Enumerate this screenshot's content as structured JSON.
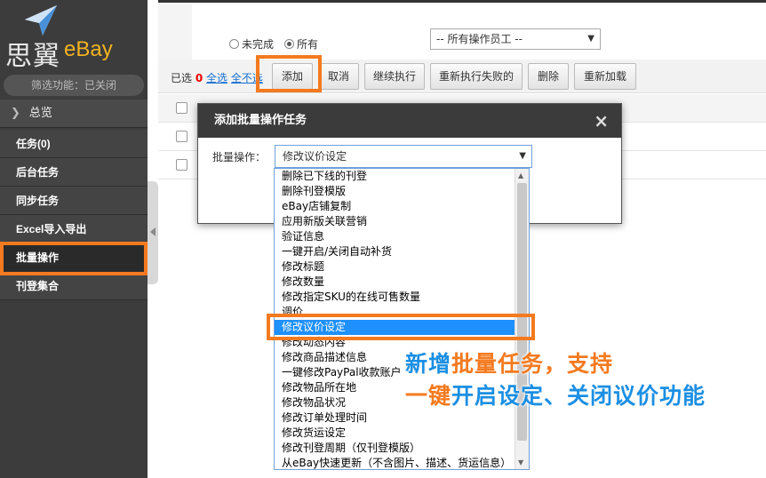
{
  "colors": {
    "accent_orange": "#f47a1f",
    "annotation_blue": "#1b8fe3",
    "sidebar_bg": "#3c3c3c",
    "selected_blue": "#1e90ff"
  },
  "sidebar": {
    "logo_cn": "思翼",
    "logo_en": "eBay",
    "filter_status": "筛选功能：已关闭",
    "overview": "总览",
    "items": [
      {
        "label": "任务(0)"
      },
      {
        "label": "后台任务"
      },
      {
        "label": "同步任务"
      },
      {
        "label": "Excel导入导出"
      },
      {
        "label": "批量操作"
      },
      {
        "label": "刊登集合"
      }
    ]
  },
  "filterbar": {
    "radio_incomplete": "未完成",
    "radio_all": "所有",
    "operator_select": "-- 所有操作员工 --"
  },
  "toolbar": {
    "selected_prefix": "已选",
    "selected_count": "0",
    "select_all": "全选",
    "select_none": "全不选",
    "buttons": {
      "add": "添加",
      "cancel": "取消",
      "continue": "继续执行",
      "retry_failed": "重新执行失败的",
      "delete": "删除",
      "reload": "重新加载"
    }
  },
  "modal": {
    "title": "添加批量操作任务",
    "close": "×",
    "field_label": "批量操作：",
    "selected_value": "修改议价设定"
  },
  "dropdown": {
    "options": [
      "删除已下线的刊登",
      "删除刊登模版",
      "eBay店铺复制",
      "应用新版关联营销",
      "验证信息",
      "一键开启/关闭自动补货",
      "修改标题",
      "修改数量",
      "修改指定SKU的在线可售数量",
      "调价",
      "修改议价设定",
      "修改动态内容",
      "修改商品描述信息",
      "一键修改PayPal收款账户",
      "修改物品所在地",
      "修改物品状况",
      "修改订单处理时间",
      "修改货运设定",
      "修改刊登周期（仅刊登模版）",
      "从eBay快速更新（不含图片、描述、货运信息）"
    ],
    "selected_index": 10
  },
  "annotation": {
    "line1_a": "新增",
    "line1_b": "批量任务，",
    "line1_c": "支持",
    "line2_a": "一键",
    "line2_b": "开启设定、关闭议价功能"
  }
}
